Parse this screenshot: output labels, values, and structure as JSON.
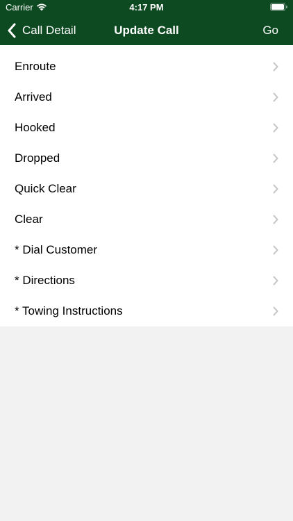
{
  "status_bar": {
    "carrier": "Carrier",
    "time": "4:17 PM",
    "wifi_icon": "wifi-icon",
    "battery_icon": "battery-icon"
  },
  "nav": {
    "back_label": "Call Detail",
    "back_icon": "chevron-left-icon",
    "title": "Update Call",
    "action_label": "Go"
  },
  "menu": {
    "items": [
      {
        "label": "Enroute"
      },
      {
        "label": "Arrived"
      },
      {
        "label": "Hooked"
      },
      {
        "label": "Dropped"
      },
      {
        "label": "Quick Clear"
      },
      {
        "label": "Clear"
      },
      {
        "label": "* Dial Customer"
      },
      {
        "label": "* Directions"
      },
      {
        "label": "* Towing Instructions"
      }
    ],
    "item_icon": "chevron-right-icon"
  },
  "colors": {
    "header_bg": "#0d4a21",
    "list_bg": "#ffffff",
    "page_bg": "#f2f2f2",
    "chevron": "#c4c4c7"
  }
}
